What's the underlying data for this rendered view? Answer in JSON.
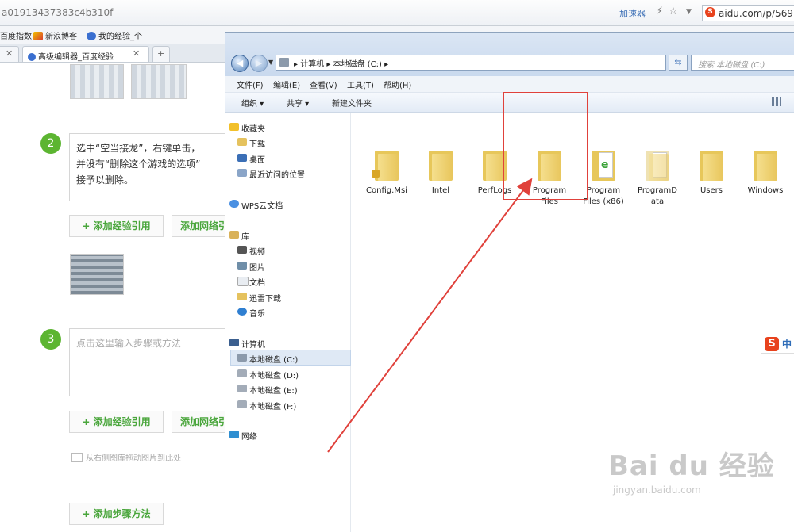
{
  "browser": {
    "url_fragment": "a01913437383c4b310f",
    "accelerator": "加速器",
    "url2": "aidu.com/p/569"
  },
  "favorites": [
    "百度指数",
    "新浪博客",
    "我的经验_个"
  ],
  "tabs": [
    {
      "label": "高级编辑器_百度经验"
    }
  ],
  "editor": {
    "step2_number": "2",
    "step2_text": "选中“空当接龙”，右键单击，\n并没有“删除这个游戏的选项”\n接予以删除。",
    "step3_number": "3",
    "step3_placeholder": "点击这里输入步骤或方法",
    "add_ref_label": "+ 添加经验引用",
    "add_web_label": "添加网络引",
    "drag_hint": "从右侧图库拖动图片到此处",
    "add_step_label": "+ 添加步骤方法"
  },
  "explorer": {
    "address": "▸ 计算机 ▸ 本地磁盘 (C:) ▸",
    "search_placeholder": "搜索 本地磁盘 (C:)",
    "menu": [
      "文件(F)",
      "编辑(E)",
      "查看(V)",
      "工具(T)",
      "帮助(H)"
    ],
    "toolbar": [
      "组织 ▾",
      "共享 ▾",
      "新建文件夹"
    ],
    "nav": {
      "favorites": "收藏夹",
      "downloads": "下载",
      "desktop": "桌面",
      "recent": "最近访问的位置",
      "wps": "WPS云文档",
      "library": "库",
      "videos": "视频",
      "pictures": "图片",
      "documents": "文档",
      "thunder": "迅雷下载",
      "music": "音乐",
      "computer": "计算机",
      "drive_c": "本地磁盘 (C:)",
      "drive_d": "本地磁盘 (D:)",
      "drive_e": "本地磁盘 (E:)",
      "drive_f": "本地磁盘 (F:)",
      "network": "网络"
    },
    "files": [
      {
        "name": "Config.Msi"
      },
      {
        "name": "Intel"
      },
      {
        "name": "PerfLogs"
      },
      {
        "name": "Program\nFiles"
      },
      {
        "name": "Program\nFiles (x86)"
      },
      {
        "name": "ProgramD\nata"
      },
      {
        "name": "Users"
      },
      {
        "name": "Windows"
      }
    ]
  },
  "ime": {
    "label": "中"
  },
  "watermark": {
    "logo": "Bai du 经验",
    "url": "jingyan.baidu.com"
  }
}
